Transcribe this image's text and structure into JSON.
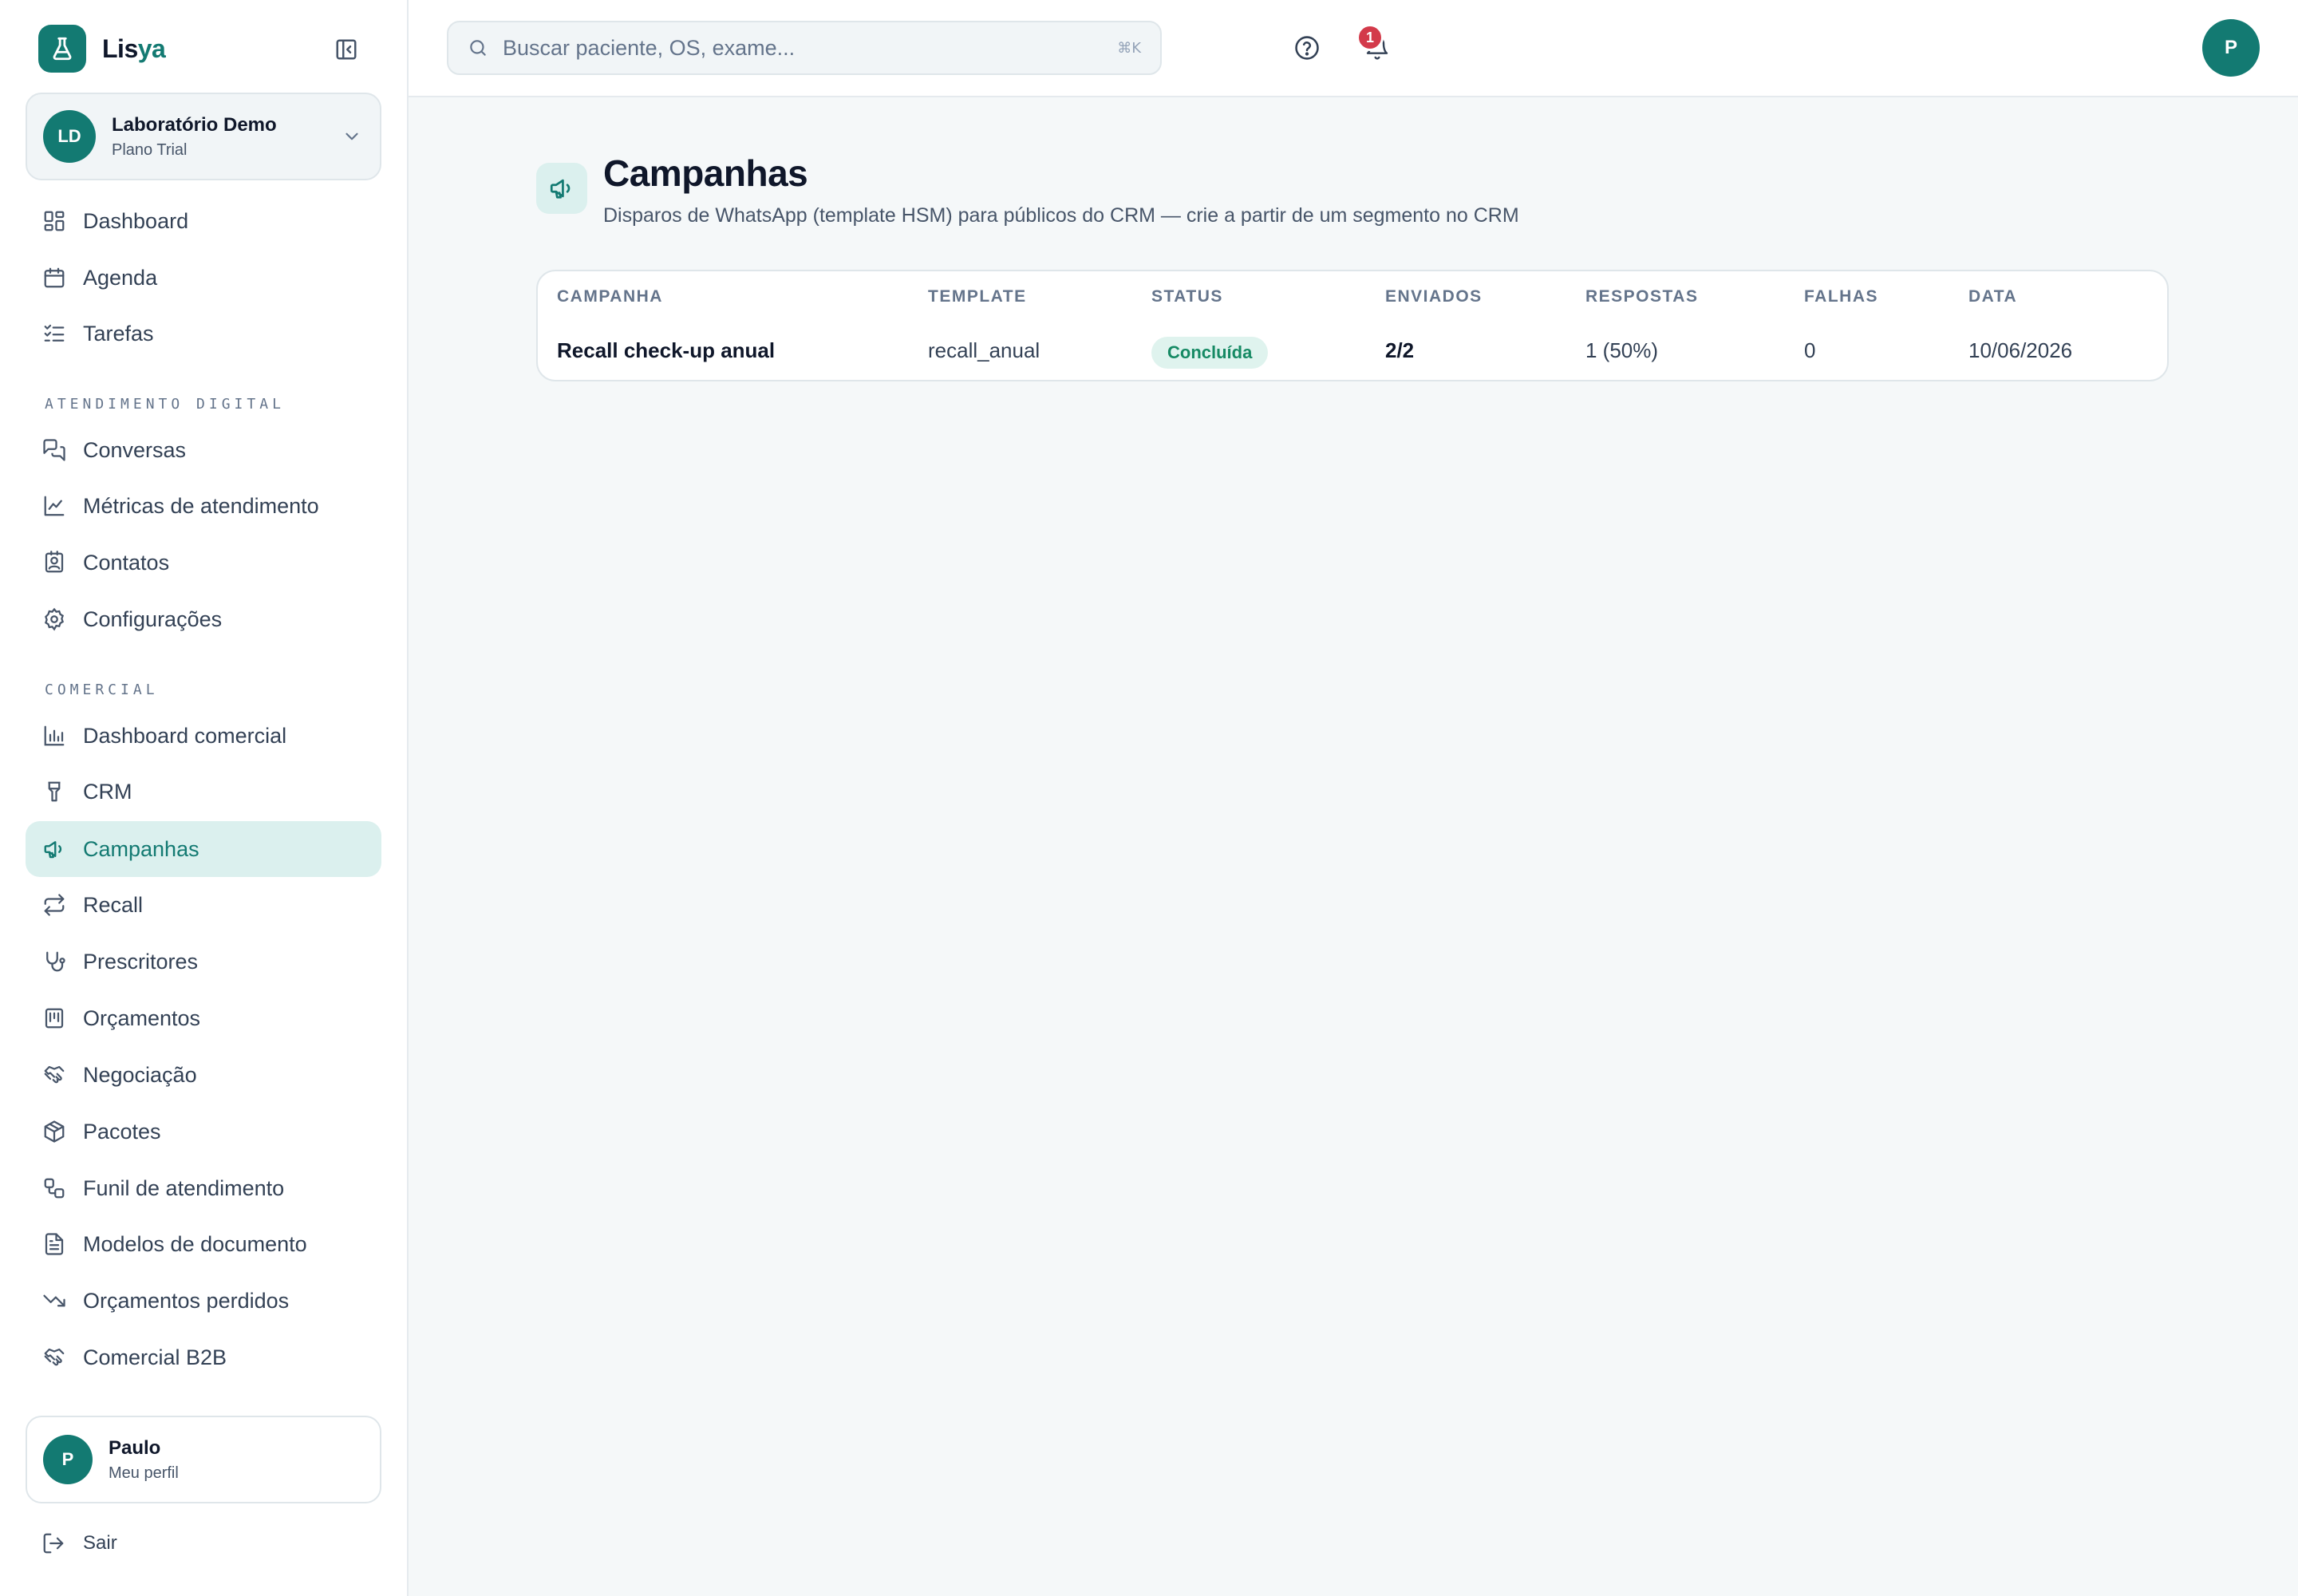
{
  "brand": {
    "name_part1": "Lis",
    "name_part2": "ya"
  },
  "organization": {
    "initials": "LD",
    "name": "Laboratório Demo",
    "plan": "Plano Trial"
  },
  "nav": {
    "main": [
      {
        "label": "Dashboard",
        "icon": "grid-icon"
      },
      {
        "label": "Agenda",
        "icon": "calendar-icon"
      },
      {
        "label": "Tarefas",
        "icon": "checklist-icon"
      }
    ],
    "section_atendimento": "ATENDIMENTO DIGITAL",
    "atendimento": [
      {
        "label": "Conversas",
        "icon": "chat-icon"
      },
      {
        "label": "Métricas de atendimento",
        "icon": "line-chart-icon"
      },
      {
        "label": "Contatos",
        "icon": "contact-card-icon"
      },
      {
        "label": "Configurações",
        "icon": "gear-icon"
      }
    ],
    "section_comercial": "COMERCIAL",
    "comercial": [
      {
        "label": "Dashboard comercial",
        "icon": "bar-chart-icon"
      },
      {
        "label": "CRM",
        "icon": "funnel-icon"
      },
      {
        "label": "Campanhas",
        "icon": "megaphone-icon",
        "active": true
      },
      {
        "label": "Recall",
        "icon": "repeat-icon"
      },
      {
        "label": "Prescritores",
        "icon": "stethoscope-icon"
      },
      {
        "label": "Orçamentos",
        "icon": "calculator-icon"
      },
      {
        "label": "Negociação",
        "icon": "handshake-icon"
      },
      {
        "label": "Pacotes",
        "icon": "package-icon"
      },
      {
        "label": "Funil de atendimento",
        "icon": "workflow-icon"
      },
      {
        "label": "Modelos de documento",
        "icon": "document-icon"
      },
      {
        "label": "Orçamentos perdidos",
        "icon": "trending-down-icon"
      },
      {
        "label": "Comercial B2B",
        "icon": "handshake-icon"
      }
    ]
  },
  "user": {
    "initial": "P",
    "name": "Paulo",
    "subtitle": "Meu perfil"
  },
  "logout_label": "Sair",
  "search": {
    "placeholder": "Buscar paciente, OS, exame...",
    "value": "",
    "shortcut": "⌘K"
  },
  "notifications": {
    "count": "1"
  },
  "top_avatar_initial": "P",
  "page": {
    "title": "Campanhas",
    "subtitle": "Disparos de WhatsApp (template HSM) para públicos do CRM — crie a partir de um segmento no CRM"
  },
  "table": {
    "columns": [
      "CAMPANHA",
      "TEMPLATE",
      "STATUS",
      "ENVIADOS",
      "RESPOSTAS",
      "FALHAS",
      "DATA"
    ],
    "rows": [
      {
        "campanha": "Recall check-up anual",
        "template": "recall_anual",
        "status": "Concluída",
        "enviados": "2/2",
        "respostas": "1 (50%)",
        "falhas": "0",
        "data": "10/06/2026"
      }
    ]
  },
  "colors": {
    "brand": "#137a72",
    "active_bg": "#dbf0ee",
    "status_done": "#168a64",
    "badge": "#d33a4a"
  }
}
